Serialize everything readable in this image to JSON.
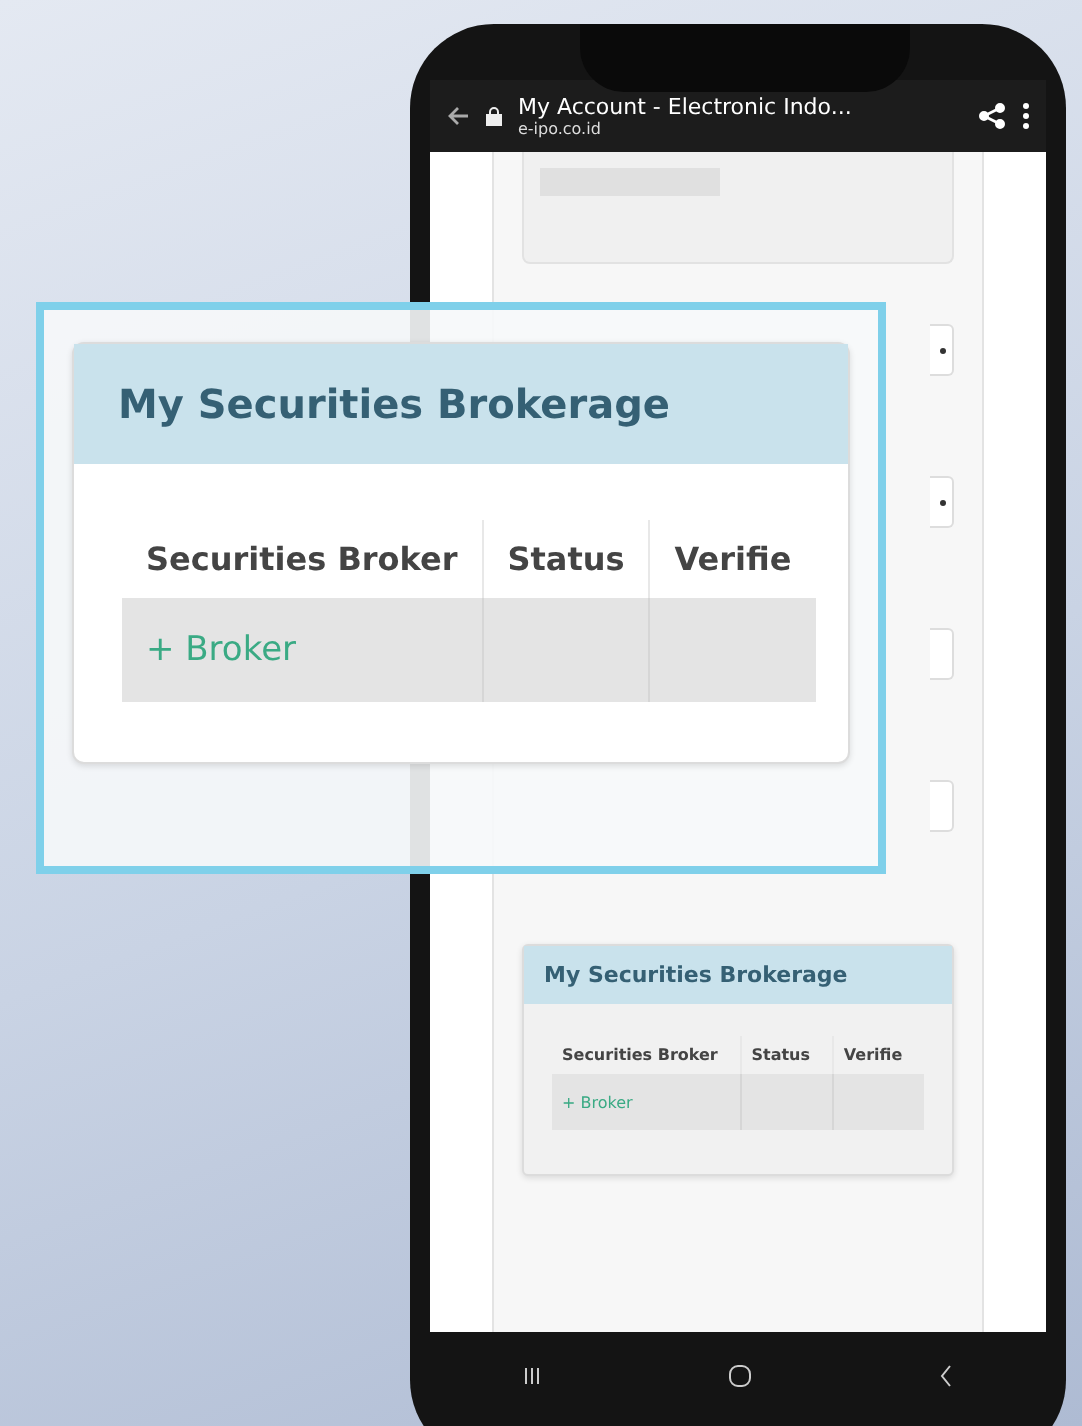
{
  "browser": {
    "title": "My Account - Electronic Indo...",
    "url": "e-ipo.co.id"
  },
  "form": {
    "fields": [
      {
        "kind": "select"
      },
      {
        "kind": "select"
      },
      {
        "kind": "input"
      },
      {
        "kind": "input"
      }
    ]
  },
  "brokerage_card": {
    "title": "My Securities Brokerage",
    "columns": [
      "Securities Broker",
      "Status",
      "Verifie"
    ],
    "add_link": "+ Broker"
  },
  "magnified_card": {
    "title": "My Securities Brokerage",
    "columns": [
      "Securities Broker",
      "Status",
      "Verifie"
    ],
    "add_link": "+ Broker"
  }
}
